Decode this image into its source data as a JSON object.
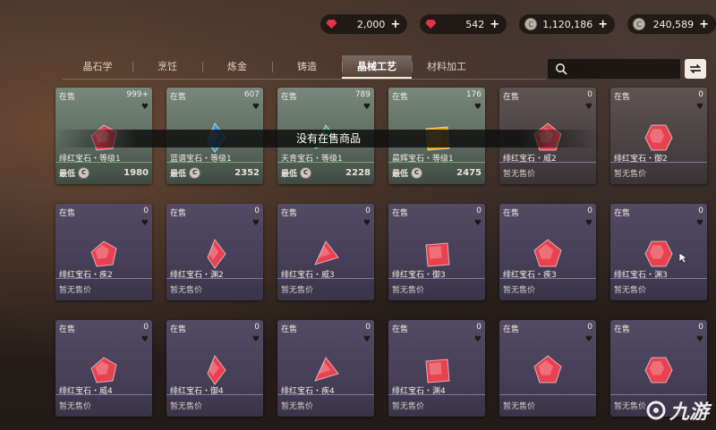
{
  "currencies": [
    {
      "icon": "ruby-gem-icon",
      "value": "2,000"
    },
    {
      "icon": "ruby-gem-icon",
      "value": "542"
    },
    {
      "icon": "silver-coin-icon",
      "value": "1,120,186"
    },
    {
      "icon": "silver-coin-icon",
      "value": "240,589"
    }
  ],
  "tabs": [
    {
      "label": "晶石学",
      "active": false
    },
    {
      "label": "烹饪",
      "active": false
    },
    {
      "label": "炼金",
      "active": false
    },
    {
      "label": "铸造",
      "active": false
    },
    {
      "label": "晶械工艺",
      "active": true
    },
    {
      "label": "材料加工",
      "active": false
    }
  ],
  "banner": "没有在售商品",
  "min_label": "最低",
  "no_price": "暂无售价",
  "watermark": "九游",
  "colors": {
    "ruby": "#e8414f",
    "blue": "#2f9be6",
    "green": "#2fbf6b",
    "gold": "#e8a317"
  },
  "items": [
    {
      "status": "在售",
      "count": "999+",
      "name": "绯红宝石・等级1",
      "price": "1980",
      "gem": "ruby",
      "bg": "green"
    },
    {
      "status": "在售",
      "count": "607",
      "name": "蓝谱宝石・等级1",
      "price": "2352",
      "gem": "blue",
      "bg": "green"
    },
    {
      "status": "在售",
      "count": "789",
      "name": "天青宝石・等级1",
      "price": "2228",
      "gem": "green",
      "bg": "green"
    },
    {
      "status": "在售",
      "count": "176",
      "name": "晨辉宝石・等级1",
      "price": "2475",
      "gem": "gold",
      "bg": "green"
    },
    {
      "status": "在售",
      "count": "0",
      "name": "绯红宝石・威2",
      "price": "",
      "gem": "ruby",
      "bg": "gray"
    },
    {
      "status": "在售",
      "count": "0",
      "name": "绯红宝石・御2",
      "price": "",
      "gem": "ruby",
      "bg": "gray"
    },
    {
      "status": "在售",
      "count": "0",
      "name": "绯红宝石・疾2",
      "price": "",
      "gem": "ruby",
      "bg": "purple"
    },
    {
      "status": "在售",
      "count": "0",
      "name": "绯红宝石・渊2",
      "price": "",
      "gem": "ruby",
      "bg": "purple"
    },
    {
      "status": "在售",
      "count": "0",
      "name": "绯红宝石・威3",
      "price": "",
      "gem": "ruby",
      "bg": "purple"
    },
    {
      "status": "在售",
      "count": "0",
      "name": "绯红宝石・御3",
      "price": "",
      "gem": "ruby",
      "bg": "purple"
    },
    {
      "status": "在售",
      "count": "0",
      "name": "绯红宝石・疾3",
      "price": "",
      "gem": "ruby",
      "bg": "purple"
    },
    {
      "status": "在售",
      "count": "0",
      "name": "绯红宝石・渊3",
      "price": "",
      "gem": "ruby",
      "bg": "purple"
    },
    {
      "status": "在售",
      "count": "0",
      "name": "绯红宝石・威4",
      "price": "",
      "gem": "ruby",
      "bg": "purple"
    },
    {
      "status": "在售",
      "count": "0",
      "name": "绯红宝石・御4",
      "price": "",
      "gem": "ruby",
      "bg": "purple"
    },
    {
      "status": "在售",
      "count": "0",
      "name": "绯红宝石・疾4",
      "price": "",
      "gem": "ruby",
      "bg": "purple"
    },
    {
      "status": "在售",
      "count": "0",
      "name": "绯红宝石・渊4",
      "price": "",
      "gem": "ruby",
      "bg": "purple"
    },
    {
      "status": "在售",
      "count": "0",
      "name": "",
      "price": "",
      "gem": "ruby",
      "bg": "purple"
    },
    {
      "status": "在售",
      "count": "0",
      "name": "",
      "price": "",
      "gem": "ruby",
      "bg": "purple"
    }
  ]
}
